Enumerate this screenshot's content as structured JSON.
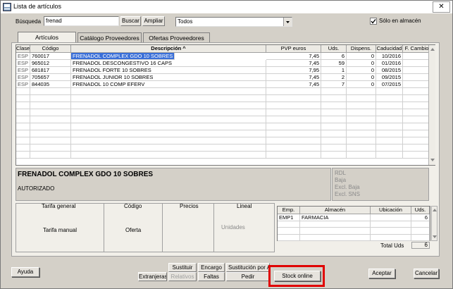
{
  "window": {
    "title": "Lista de artículos",
    "close": "✕"
  },
  "search": {
    "label": "Búsqueda",
    "value": "frenad",
    "buscar": "Buscar",
    "ampliar": "Ampliar",
    "filter": "Todos",
    "solo_almacen": "Sólo en almacén",
    "solo_almacen_checked": true
  },
  "tabs": [
    "Artículos",
    "Catálogo Proveedores",
    "Ofertas Proveedores"
  ],
  "articles": {
    "columns": [
      "Clase",
      "Código",
      "Descripción ^",
      "PVP euros",
      "Uds.",
      "Dispens.",
      "Caducidad",
      "F. Cambio"
    ],
    "rows": [
      {
        "clase": "ESP",
        "codigo": "760017",
        "desc": "FRENADOL COMPLEX GDO 10 SOBRES",
        "pvp": "7,45",
        "uds": "6",
        "disp": "0",
        "cad": "10/2016",
        "fcambio": ""
      },
      {
        "clase": "ESP",
        "codigo": "965012",
        "desc": "FRENADOL DESCONGESTIVO 16 CAPS",
        "pvp": "7,45",
        "uds": "59",
        "disp": "0",
        "cad": "01/2016",
        "fcambio": ""
      },
      {
        "clase": "ESP",
        "codigo": "681817",
        "desc": "FRENADOL FORTE 10 SOBRES",
        "pvp": "7,95",
        "uds": "1",
        "disp": "0",
        "cad": "08/2015",
        "fcambio": ""
      },
      {
        "clase": "ESP",
        "codigo": "705657",
        "desc": "FRENADOL JUNIOR 10 SOBRES",
        "pvp": "7,45",
        "uds": "2",
        "disp": "0",
        "cad": "09/2015",
        "fcambio": ""
      },
      {
        "clase": "ESP",
        "codigo": "844035",
        "desc": "FRENADOL 10 COMP EFERV",
        "pvp": "7,45",
        "uds": "7",
        "disp": "0",
        "cad": "07/2015",
        "fcambio": ""
      }
    ],
    "selected_row": 0
  },
  "detail": {
    "name": "FRENADOL COMPLEX GDO 10 SOBRES",
    "status": "AUTORIZADO",
    "flags": [
      "RDL",
      "Baja",
      "Excl. Baja",
      "Excl. SNS"
    ]
  },
  "tarifa": {
    "tarifa_general": "Tarifa general",
    "codigo": "Código",
    "precios": "Precios",
    "lineal": "Lineal",
    "tarifa_manual": "Tarifa manual",
    "oferta": "Oferta",
    "unidades": "Unidades"
  },
  "stock": {
    "columns": [
      "Emp.",
      "Almacén",
      "Ubicación",
      "Uds."
    ],
    "rows": [
      {
        "emp": "EMP1",
        "almacen": "FARMACIA",
        "ubicacion": "",
        "uds": "6"
      }
    ],
    "total_label": "Total Uds",
    "total_value": "6"
  },
  "buttons": {
    "ayuda": "Ayuda",
    "sustituir": "Sustituir",
    "encargo": "Encargo",
    "sustitucion": "Sustitución por AH",
    "extranjeras": "Extranjeras",
    "relativos": "Relativos",
    "faltas": "Faltas",
    "pedir": "Pedir",
    "stock_online": "Stock online",
    "aceptar": "Aceptar",
    "cancelar": "Cancelar"
  },
  "colors": {
    "selected_row": "#fad39a",
    "highlight_box": "#e00000",
    "window_bg": "#d4d0c8"
  }
}
